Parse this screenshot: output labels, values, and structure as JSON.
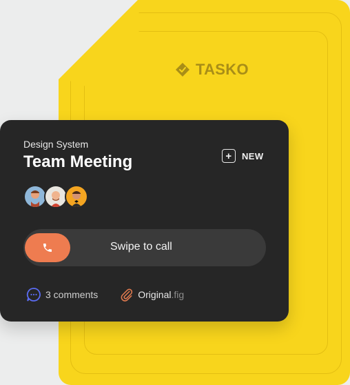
{
  "brand": {
    "name": "TASKO"
  },
  "card": {
    "category": "Design System",
    "title": "Team Meeting",
    "new_label": "NEW",
    "swipe_label": "Swipe to call",
    "comments_label": "3 comments",
    "file_name": "Original",
    "file_ext": ".fig"
  },
  "colors": {
    "accent_yellow": "#f8d51c",
    "card_bg": "#262626",
    "call_button": "#ee7c50",
    "comment_icon": "#5b6cf2",
    "attachment_icon": "#e07a4f"
  }
}
